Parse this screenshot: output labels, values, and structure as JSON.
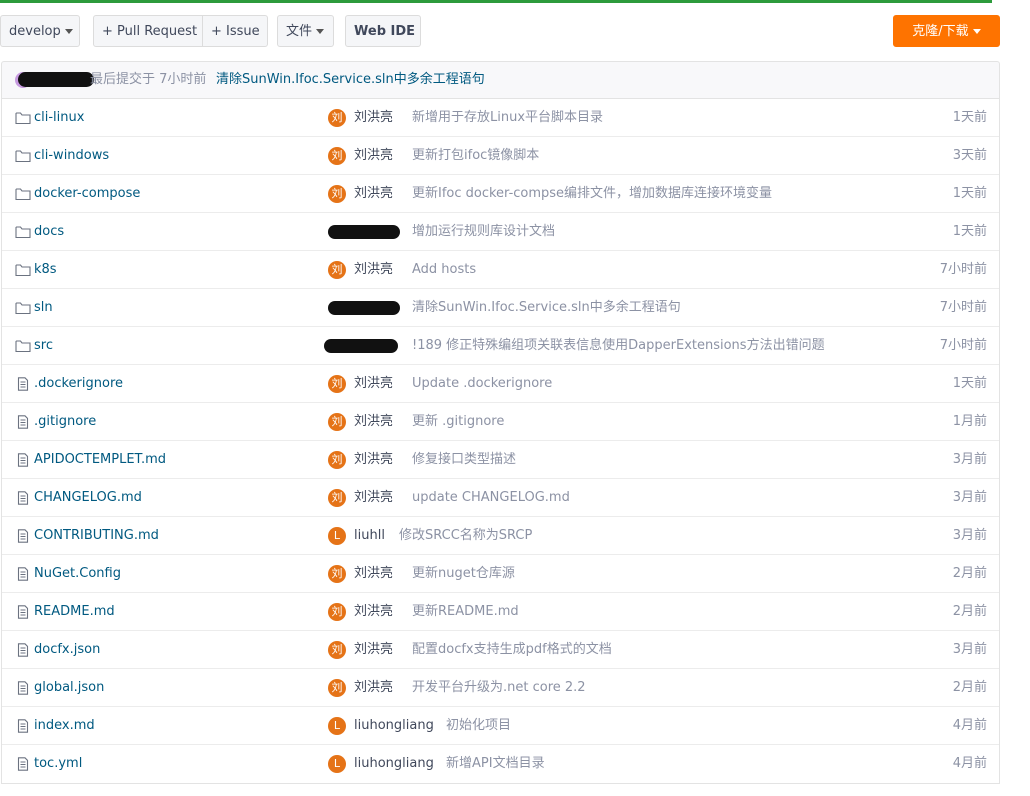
{
  "toolbar": {
    "branch": "develop",
    "pull_request": "+ Pull Request",
    "issue": "+ Issue",
    "file_menu": "文件",
    "web_ide": "Web IDE",
    "clone": "克隆/下载"
  },
  "commit_bar": {
    "meta": "最后提交于 7小时前",
    "message": "清除SunWin.Ifoc.Service.sln中多余工程语句"
  },
  "files": [
    {
      "type": "folder",
      "name": "cli-linux",
      "avatar": "刘",
      "author": "刘洪亮",
      "message": "新增用于存放Linux平台脚本目录",
      "time": "1天前"
    },
    {
      "type": "folder",
      "name": "cli-windows",
      "avatar": "刘",
      "author": "刘洪亮",
      "message": "更新打包ifoc镜像脚本",
      "time": "3天前"
    },
    {
      "type": "folder",
      "name": "docker-compose",
      "avatar": "刘",
      "author": "刘洪亮",
      "message": "更新Ifoc docker-compse编排文件，增加数据库连接环境变量",
      "time": "1天前"
    },
    {
      "type": "folder",
      "name": "docs",
      "avatar": "",
      "author": "",
      "message": "增加运行规则库设计文档",
      "time": "1天前",
      "redacted": true
    },
    {
      "type": "folder",
      "name": "k8s",
      "avatar": "刘",
      "author": "刘洪亮",
      "message": "Add hosts",
      "time": "7小时前"
    },
    {
      "type": "folder",
      "name": "sln",
      "avatar": "",
      "author": "",
      "message": "清除SunWin.Ifoc.Service.sln中多余工程语句",
      "time": "7小时前",
      "redacted": true
    },
    {
      "type": "folder",
      "name": "src",
      "avatar": "",
      "author": "",
      "message": "!189 修正特殊编组项关联表信息使用DapperExtensions方法出错问题",
      "time": "7小时前",
      "redacted": true
    },
    {
      "type": "file",
      "name": ".dockerignore",
      "avatar": "刘",
      "author": "刘洪亮",
      "message": "Update .dockerignore",
      "time": "1天前"
    },
    {
      "type": "file",
      "name": ".gitignore",
      "avatar": "刘",
      "author": "刘洪亮",
      "message": "更新 .gitignore",
      "time": "1月前"
    },
    {
      "type": "file",
      "name": "APIDOCTEMPLET.md",
      "avatar": "刘",
      "author": "刘洪亮",
      "message": "修复接口类型描述",
      "time": "3月前"
    },
    {
      "type": "file",
      "name": "CHANGELOG.md",
      "avatar": "刘",
      "author": "刘洪亮",
      "message": "update CHANGELOG.md",
      "time": "3月前"
    },
    {
      "type": "file",
      "name": "CONTRIBUTING.md",
      "avatar": "L",
      "author": "liuhll",
      "message": "修改SRCC名称为SRCP",
      "time": "3月前"
    },
    {
      "type": "file",
      "name": "NuGet.Config",
      "avatar": "刘",
      "author": "刘洪亮",
      "message": "更新nuget仓库源",
      "time": "2月前"
    },
    {
      "type": "file",
      "name": "README.md",
      "avatar": "刘",
      "author": "刘洪亮",
      "message": "更新README.md",
      "time": "2月前"
    },
    {
      "type": "file",
      "name": "docfx.json",
      "avatar": "刘",
      "author": "刘洪亮",
      "message": "配置docfx支持生成pdf格式的文档",
      "time": "3月前"
    },
    {
      "type": "file",
      "name": "global.json",
      "avatar": "刘",
      "author": "刘洪亮",
      "message": "开发平台升级为.net core 2.2",
      "time": "2月前"
    },
    {
      "type": "file",
      "name": "index.md",
      "avatar": "L",
      "author": "liuhongliang",
      "message": "初始化项目",
      "time": "4月前"
    },
    {
      "type": "file",
      "name": "toc.yml",
      "avatar": "L",
      "author": "liuhongliang",
      "message": "新增API文档目录",
      "time": "4月前"
    }
  ]
}
